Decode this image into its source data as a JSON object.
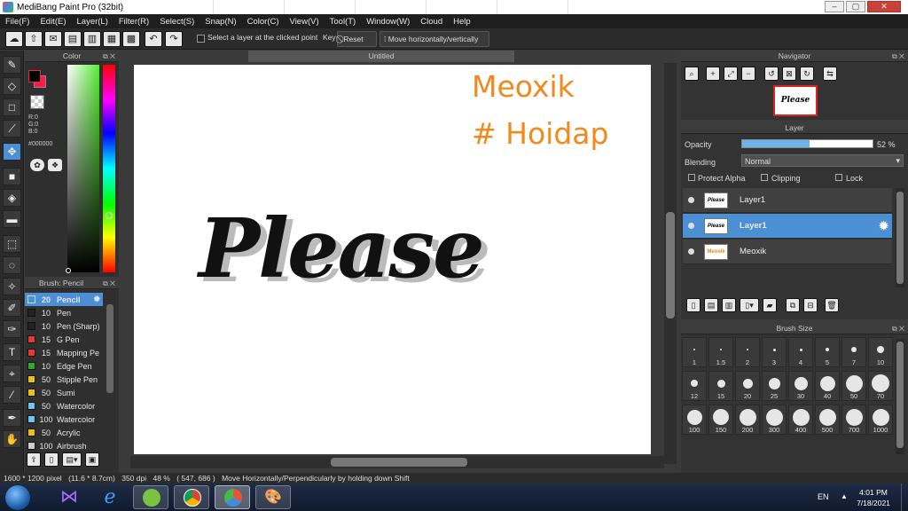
{
  "window": {
    "title": "MediBang Paint Pro (32bit)"
  },
  "menu": [
    "File(F)",
    "Edit(E)",
    "Layer(L)",
    "Filter(R)",
    "Select(S)",
    "Snap(N)",
    "Color(C)",
    "View(V)",
    "Tool(T)",
    "Window(W)",
    "Cloud",
    "Help"
  ],
  "toolbar": {
    "select_layer_label": "Select a layer at the clicked point",
    "key_label": "Key",
    "reset_label": "Reset",
    "move_label": "Move horizontally/vertically"
  },
  "color_panel": {
    "title": "Color",
    "r": "R:0",
    "g": "G:0",
    "b": "B:0",
    "hex": "#000000",
    "fg_color": "#000000",
    "bg_color": "#ff1a4a"
  },
  "brush_panel": {
    "title": "Brush: Pencil",
    "items": [
      {
        "size": "20",
        "name": "Pencil",
        "color": "#4b8fd4"
      },
      {
        "size": "10",
        "name": "Pen",
        "color": "#222222"
      },
      {
        "size": "10",
        "name": "Pen (Sharp)",
        "color": "#222222"
      },
      {
        "size": "15",
        "name": "G Pen",
        "color": "#e53935"
      },
      {
        "size": "15",
        "name": "Mapping Pe",
        "color": "#e53935"
      },
      {
        "size": "10",
        "name": "Edge Pen",
        "color": "#2fa82f"
      },
      {
        "size": "50",
        "name": "Stipple Pen",
        "color": "#e8c21a"
      },
      {
        "size": "50",
        "name": "Sumi",
        "color": "#e8c21a"
      },
      {
        "size": "50",
        "name": "Watercolor",
        "color": "#6cc6f0"
      },
      {
        "size": "100",
        "name": "Watercolor",
        "color": "#6cc6f0"
      },
      {
        "size": "50",
        "name": "Acrylic",
        "color": "#e8c21a"
      },
      {
        "size": "100",
        "name": "Airbrush",
        "color": "#cccccc"
      }
    ]
  },
  "canvas": {
    "tab_title": "Untitled",
    "drawn_word": "Please",
    "text_line1": "Meoxik",
    "text_line2": "# Hoidap"
  },
  "navigator": {
    "title": "Navigator",
    "thumb_text": "Please"
  },
  "layer_panel": {
    "title": "Layer",
    "opacity_label": "Opacity",
    "opacity_value": "52 %",
    "opacity_fraction": 0.52,
    "blending_label": "Blending",
    "blending_value": "Normal",
    "protect_alpha": "Protect Alpha",
    "clipping": "Clipping",
    "lock": "Lock",
    "layers": [
      {
        "name": "Layer1",
        "thumb": "Please"
      },
      {
        "name": "Layer1",
        "thumb": "Please"
      },
      {
        "name": "Meoxik",
        "thumb": "Meoxik"
      }
    ]
  },
  "brush_size_panel": {
    "title": "Brush Size",
    "sizes": [
      "1",
      "1.5",
      "2",
      "3",
      "4",
      "5",
      "7",
      "10",
      "12",
      "15",
      "20",
      "25",
      "30",
      "40",
      "50",
      "70",
      "100",
      "150",
      "200",
      "300",
      "400",
      "500",
      "700",
      "1000"
    ]
  },
  "status": {
    "size": "1600 * 1200 pixel",
    "dims": "(11.6 * 8.7cm)",
    "dpi": "350 dpi",
    "zoom": "48 %",
    "coords": "( 547, 686 )",
    "hint": "Move Horizontally/Perpendicularly by holding down Shift"
  },
  "taskbar": {
    "lang": "EN",
    "time": "4:01 PM",
    "date": "7/18/2021"
  }
}
